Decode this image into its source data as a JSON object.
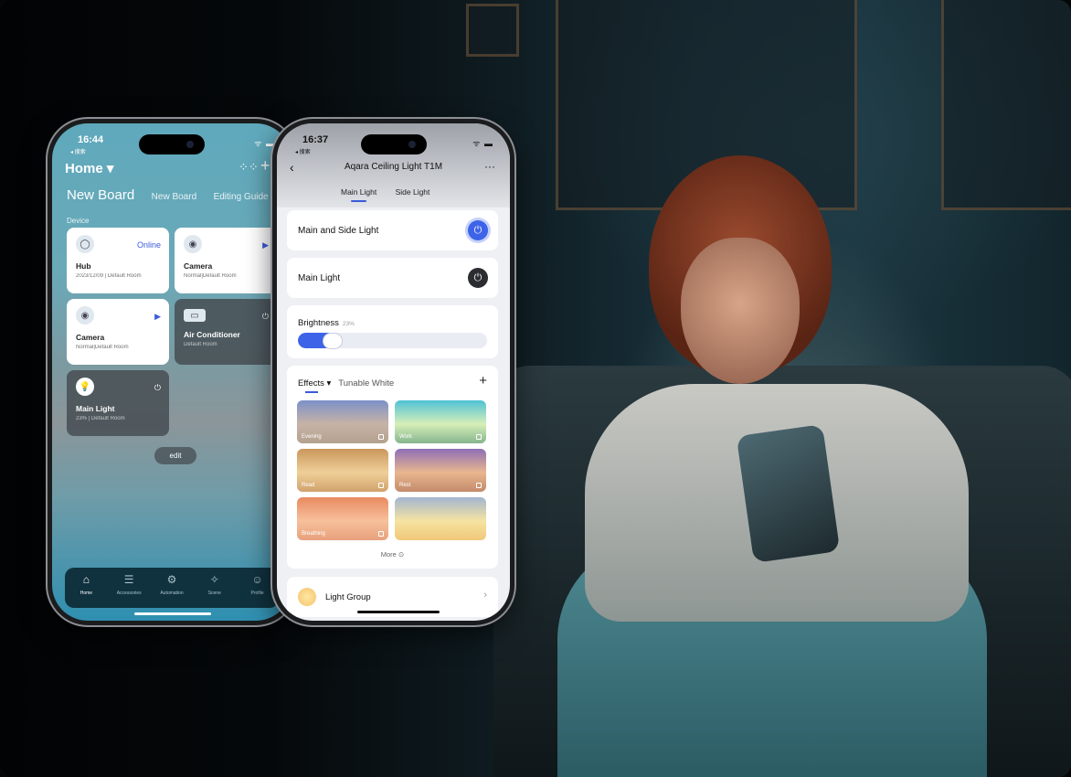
{
  "phone_home": {
    "time": "16:44",
    "back_label": "◂ 搜索",
    "home_label": "Home ▾",
    "board_title": "New Board",
    "board_tabs": [
      "New Board",
      "Editing Guide"
    ],
    "device_section": "Device",
    "cards": [
      {
        "name": "Hub",
        "sub": "2023/12/09 | Default Room",
        "badge": "Online"
      },
      {
        "name": "Camera",
        "sub": "Normal|Default Room",
        "badge": "▶"
      },
      {
        "name": "Camera",
        "sub": "Normal|Default Room",
        "badge": "▶"
      },
      {
        "name": "Air Conditioner",
        "sub": "Default Room",
        "badge": "⏻"
      },
      {
        "name": "Main Light",
        "sub": "23% | Default Room",
        "badge": "⏻"
      }
    ],
    "edit_label": "edit",
    "tabs": [
      "Home",
      "Accessories",
      "Automation",
      "Scene",
      "Profile"
    ]
  },
  "phone_light": {
    "time": "16:37",
    "back_label": "◂ 搜索",
    "title": "Aqara Ceiling Light T1M",
    "tabs": [
      "Main Light",
      "Side Light"
    ],
    "main_side_label": "Main and Side Light",
    "main_light_label": "Main Light",
    "brightness_label": "Brightness",
    "brightness_percent": "23%",
    "brightness_value": 23,
    "effects_label": "Effects ▾",
    "tunable_label": "Tunable White",
    "effects": [
      "Evening",
      "Work",
      "Read",
      "Rest",
      "Breathing",
      ""
    ],
    "more_label": "More ⊙",
    "light_group_label": "Light Group"
  },
  "colors": {
    "accent": "#3d63e8",
    "power_on": "#3d63e8",
    "power_off": "#2b2d31"
  }
}
